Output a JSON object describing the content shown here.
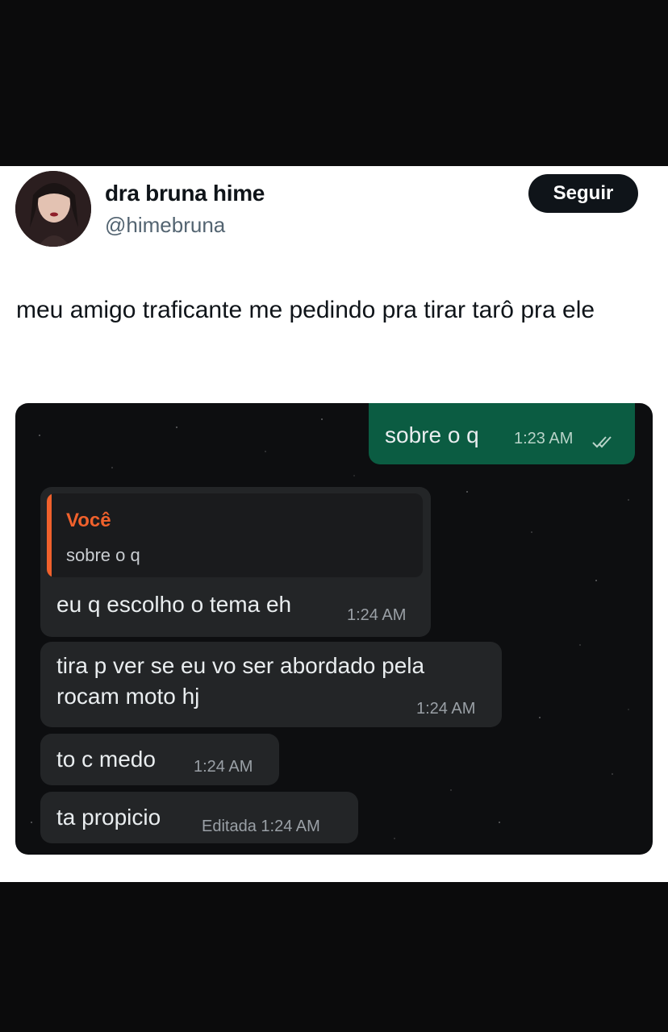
{
  "tweet": {
    "display_name": "dra bruna hime",
    "handle": "@himebruna",
    "follow_label": "Seguir",
    "text": "meu amigo traficante me pedindo pra tirar tarô pra ele"
  },
  "chat": {
    "sent": {
      "text": "sobre o q",
      "time": "1:23 AM",
      "status_icon": "double-check-icon"
    },
    "quote": {
      "author": "Você",
      "text": "sobre o q"
    },
    "received": [
      {
        "text": "eu q escolho o tema eh",
        "time": "1:24 AM"
      },
      {
        "text_line1": "tira p ver se eu vo ser abordado pela",
        "text_line2": "rocam moto hj",
        "time": "1:24 AM"
      },
      {
        "text": "to c medo",
        "time": "1:24 AM"
      },
      {
        "text": "ta propicio",
        "time": "Editada 1:24 AM"
      }
    ]
  },
  "colors": {
    "sent_bubble": "#0b5c42",
    "received_bubble": "#232527",
    "quote_accent": "#f0612c",
    "follow_button": "#0f1419"
  }
}
